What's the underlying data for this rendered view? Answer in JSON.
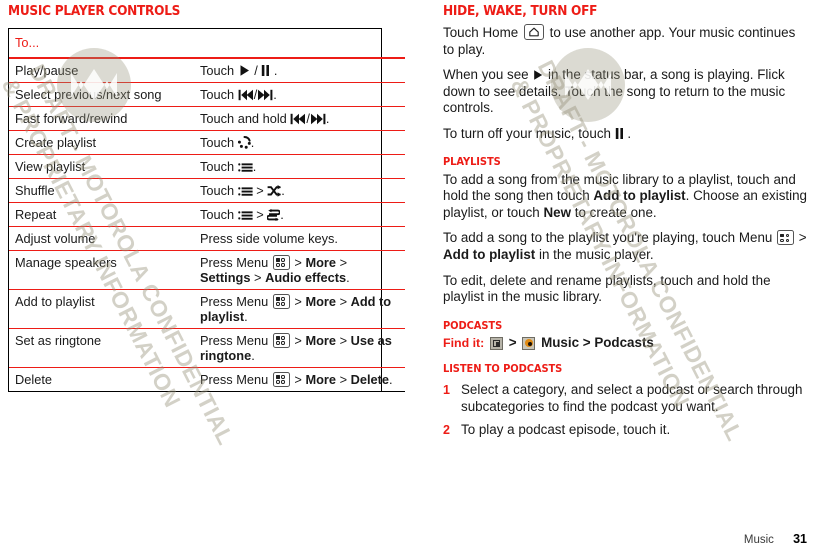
{
  "left_column": {
    "heading": "Music player controls",
    "table": {
      "header": [
        "To...",
        ""
      ],
      "rows": [
        {
          "label": "Play/pause",
          "action_prefix": "Touch ",
          "icons": [
            "play",
            "slash",
            "pause"
          ],
          "action_suffix": " ."
        },
        {
          "label": "Select previous/next song",
          "action_prefix": "Touch ",
          "icons": [
            "prev",
            "slash",
            "next"
          ],
          "action_suffix": "."
        },
        {
          "label": "Fast forward/rewind",
          "action_prefix": "Touch and hold ",
          "icons": [
            "prev",
            "slash",
            "next"
          ],
          "action_suffix": "."
        },
        {
          "label": "Create playlist",
          "action_prefix": "Touch ",
          "icons": [
            "createplaylist"
          ],
          "action_suffix": "."
        },
        {
          "label": "View playlist",
          "action_prefix": "Touch ",
          "icons": [
            "list"
          ],
          "action_suffix": "."
        },
        {
          "label": "Shuffle",
          "action_prefix": "Touch ",
          "icons": [
            "list",
            "gt",
            "shuffle"
          ],
          "action_suffix": "."
        },
        {
          "label": "Repeat",
          "action_prefix": "Touch ",
          "icons": [
            "list",
            "gt",
            "repeat"
          ],
          "action_suffix": "."
        },
        {
          "label": "Adjust volume",
          "action_plain": "Press side volume keys."
        },
        {
          "label": "Manage speakers",
          "menu_path": [
            "More",
            "Settings",
            "Audio effects"
          ]
        },
        {
          "label": "Add to playlist",
          "menu_path": [
            "More",
            "Add to playlist"
          ]
        },
        {
          "label": "Set as ringtone",
          "menu_path": [
            "More",
            "Use as ringtone"
          ]
        },
        {
          "label": "Delete",
          "menu_path": [
            "More",
            "Delete"
          ]
        }
      ],
      "press_menu_label": "Press Menu"
    }
  },
  "right_column": {
    "hide_wake": {
      "heading": "Hide, wake, turn off",
      "p1_a": "Touch Home ",
      "p1_b": " to use another app. Your music continues to play.",
      "p2_a": "When you see ",
      "p2_b": " in the status bar, a song is playing. Flick down to see details. Touch the song to return to the music controls.",
      "p3_a": "To turn off your music, touch ",
      "p3_b": " ."
    },
    "playlists": {
      "heading": "Playlists",
      "p1_a": "To add a song from the music library to a playlist, touch and hold the song then touch ",
      "p1_bold1": "Add to playlist",
      "p1_b": ". Choose an existing playlist, or touch ",
      "p1_bold2": "New",
      "p1_c": " to create one.",
      "p2_a": "To add a song to the playlist you're playing, touch Menu ",
      "p2_b": " > ",
      "p2_bold": "Add to playlist",
      "p2_c": " in the music player.",
      "p3": "To edit, delete and rename playlists, touch and hold the playlist in the music library."
    },
    "podcasts": {
      "heading": "Podcasts",
      "find_it_label": "Find it:",
      "find_it_sep1": ">",
      "find_it_app": "Music",
      "find_it_sep2": ">",
      "find_it_target": "Podcasts",
      "listen_heading": "Listen to podcasts",
      "steps": [
        {
          "num": "1",
          "text": "Select a category, and select a podcast or search through subcategories to find the podcast you want."
        },
        {
          "num": "2",
          "text": "To play a podcast episode, touch it."
        }
      ]
    }
  },
  "footer": {
    "section": "Music",
    "page": "31"
  },
  "watermark": {
    "line1": "DRAFT - MOTOROLA CONFIDENTIAL",
    "line2": "& PROPRIETARY INFORMATION"
  },
  "colors": {
    "accent_red": "#ed1c16",
    "text": "#1a1a1a",
    "watermark": "rgba(150,146,122,0.42)"
  }
}
